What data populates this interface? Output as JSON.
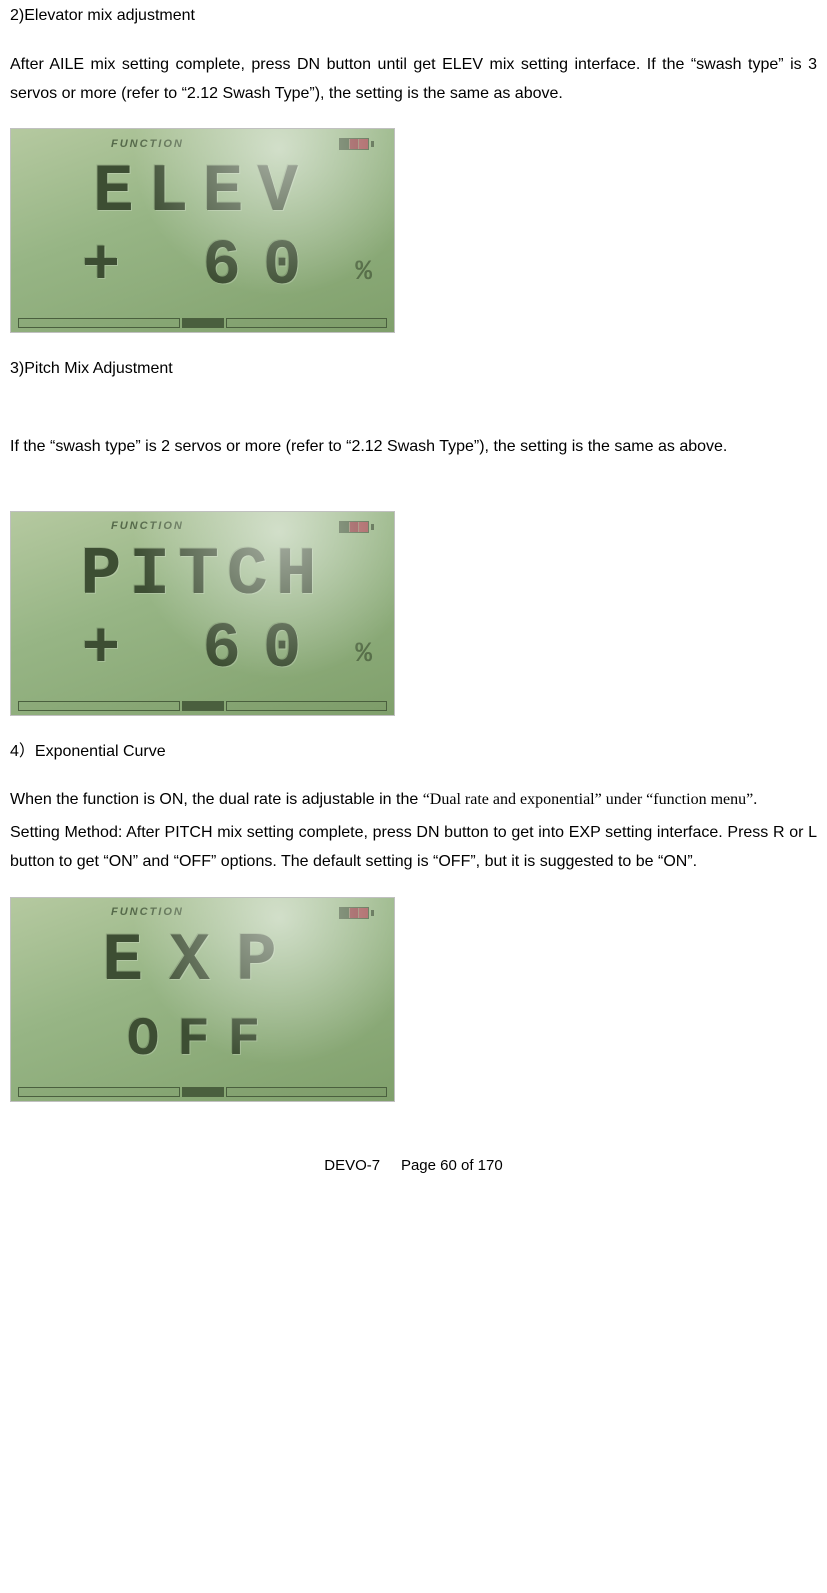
{
  "section2": {
    "title": "2)Elevator mix adjustment",
    "para": "After AILE mix setting complete, press DN button until get ELEV mix setting interface. If the “swash type” is 3 servos or more (refer to “2.12 Swash Type”), the setting is the same as above."
  },
  "lcd1": {
    "topLabel": "FUNCTION",
    "line1": "ELEV",
    "line2": "+ 60",
    "percent": "%"
  },
  "section3": {
    "title": "3)Pitch Mix Adjustment",
    "para": "If the “swash type” is 2 servos or more (refer to “2.12 Swash Type”), the setting is the same as above."
  },
  "lcd2": {
    "topLabel": "FUNCTION",
    "line1": "PITCH",
    "line2": "+ 60",
    "percent": "%"
  },
  "section4": {
    "title": "4）Exponential Curve",
    "para1a": "When the function is ON, the dual rate is adjustable in the ",
    "para1b": "“Dual rate and exponential” under “function menu”.",
    "para2": "Setting Method: After PITCH mix setting complete, press DN button to get into EXP setting interface. Press R or L button to get “ON” and “OFF” options. The default setting is “OFF”, but it is suggested to be “ON”."
  },
  "lcd3": {
    "topLabel": "FUNCTION",
    "line1": "EXP",
    "line2": "OFF"
  },
  "footer": "DEVO-7     Page 60 of 170"
}
